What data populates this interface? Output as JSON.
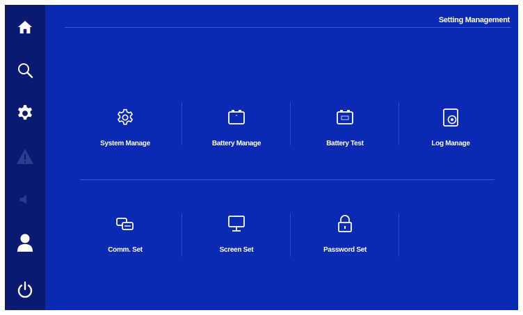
{
  "sidebar": {
    "items": [
      {
        "icon": "home-icon",
        "active": false
      },
      {
        "icon": "search-icon",
        "active": false
      },
      {
        "icon": "gear-icon",
        "active": true
      },
      {
        "icon": "warning-icon",
        "active": false
      },
      {
        "icon": "speaker-icon",
        "active": false
      },
      {
        "icon": "user-icon",
        "active": true
      },
      {
        "icon": "power-icon",
        "active": true
      }
    ]
  },
  "header": {
    "title": "Setting Management"
  },
  "menu": {
    "row1": [
      {
        "label": "System Manage",
        "icon": "gear-icon"
      },
      {
        "label": "Battery Manage",
        "icon": "battery-icon"
      },
      {
        "label": "Battery Test",
        "icon": "battery-test-icon"
      },
      {
        "label": "Log Manage",
        "icon": "log-icon"
      }
    ],
    "row2": [
      {
        "label": "Comm. Set",
        "icon": "comm-icon"
      },
      {
        "label": "Screen Set",
        "icon": "monitor-icon"
      },
      {
        "label": "Password Set",
        "icon": "lock-icon"
      }
    ]
  },
  "colors": {
    "background": "#0a2ab3",
    "sidebar": "#0a1a73",
    "icon_active": "#ffffff",
    "icon_dim": "#2c3d8f",
    "divider": "#2f5fe0"
  }
}
